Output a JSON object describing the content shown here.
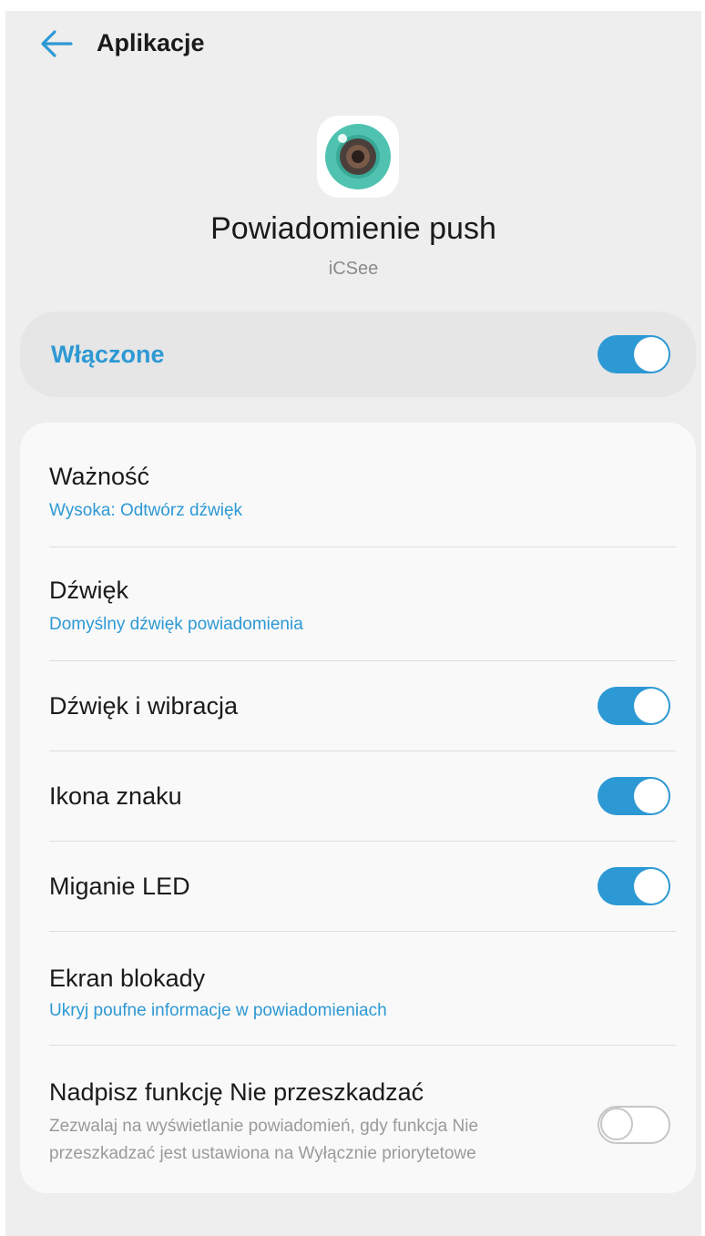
{
  "header": {
    "back_icon": "arrow-left-icon",
    "title": "Aplikacje"
  },
  "app": {
    "icon": "camera-lens-icon",
    "page_title": "Powiadomienie push",
    "name": "iCSee"
  },
  "master_switch": {
    "label": "Włączone",
    "state": "on"
  },
  "settings": [
    {
      "title": "Ważność",
      "subtitle": "Wysoka: Odtwórz dźwięk"
    },
    {
      "title": "Dźwięk",
      "subtitle": "Domyślny dźwięk powiadomienia"
    },
    {
      "title": "Dźwięk i wibracja",
      "toggle": "on"
    },
    {
      "title": "Ikona znaku",
      "toggle": "on"
    },
    {
      "title": "Miganie LED",
      "toggle": "on"
    },
    {
      "title": "Ekran blokady",
      "subtitle": "Ukryj poufne informacje w powiadomieniach"
    },
    {
      "title": "Nadpisz funkcję Nie przeszkadzać",
      "description": "Zezwalaj na wyświetlanie powiadomień, gdy funkcja Nie przeszkadzać jest ustawiona na Wyłącznie priorytetowe",
      "toggle": "off"
    }
  ],
  "colors": {
    "accent": "#2d99d4",
    "background": "#eeeeee",
    "card": "#f9f9f9",
    "icon_teal": "#4fc3b0"
  }
}
